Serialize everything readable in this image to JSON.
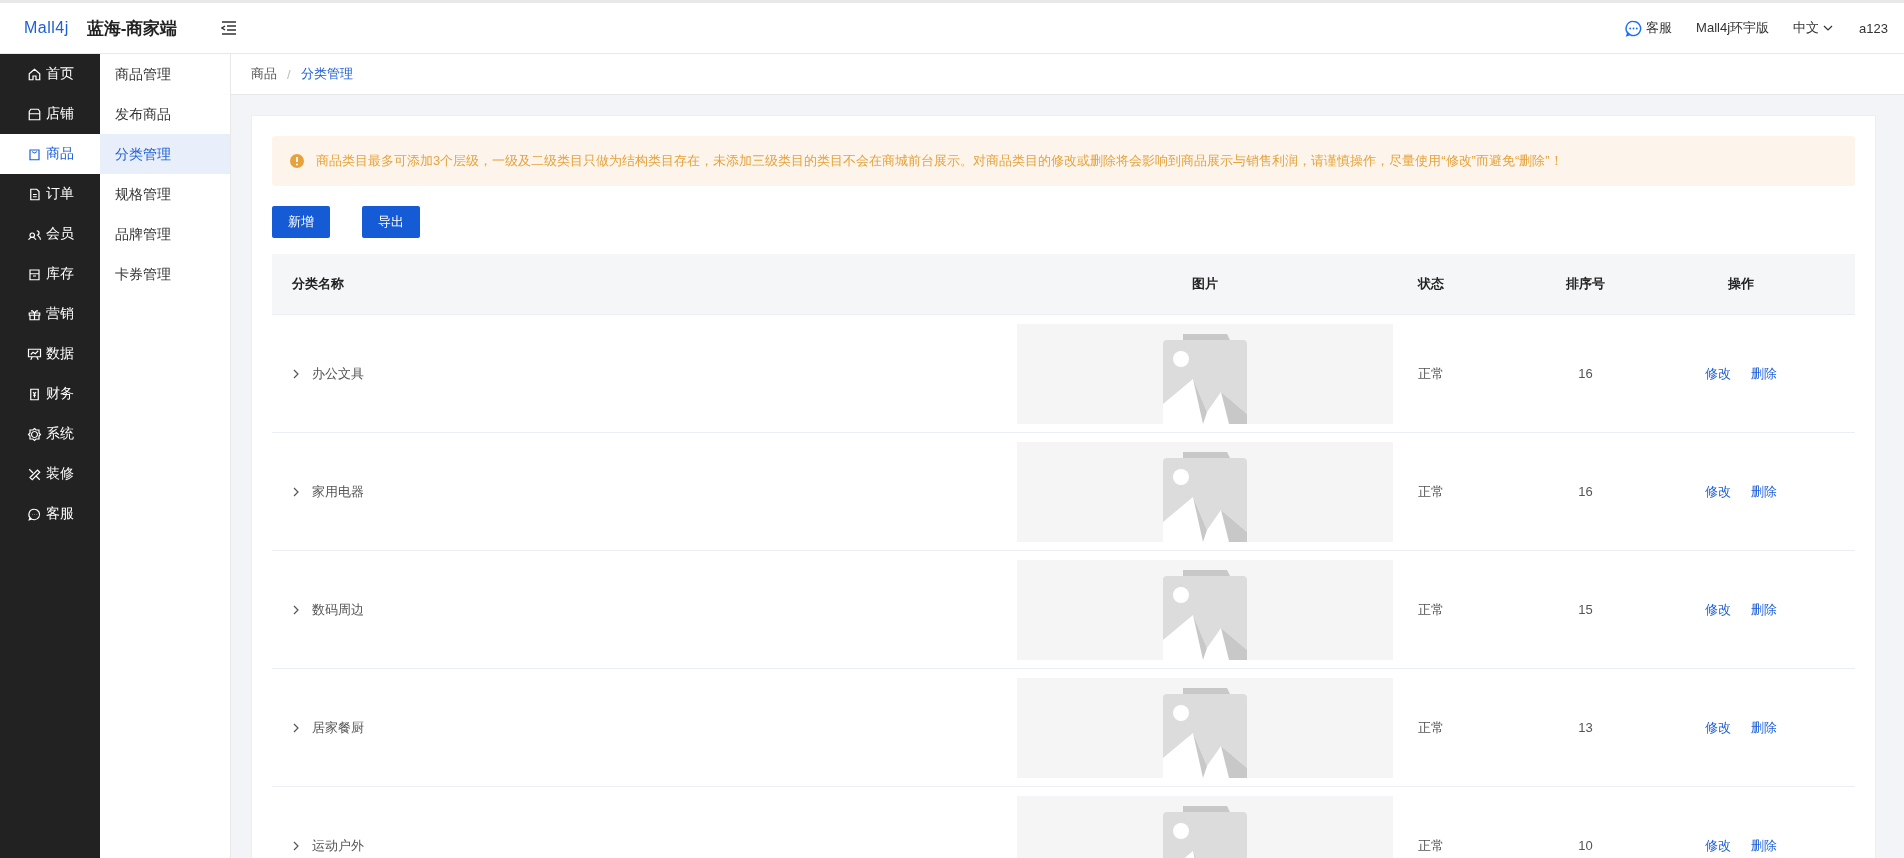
{
  "header": {
    "logo": "Mall4j",
    "title": "蓝海-商家端",
    "service": "客服",
    "edition": "Mall4j环宇版",
    "language": "中文",
    "user": "a123"
  },
  "sidebar": {
    "items": [
      {
        "label": "首页",
        "selected": false
      },
      {
        "label": "店铺",
        "selected": false
      },
      {
        "label": "商品",
        "selected": true
      },
      {
        "label": "订单",
        "selected": false
      },
      {
        "label": "会员",
        "selected": false
      },
      {
        "label": "库存",
        "selected": false
      },
      {
        "label": "营销",
        "selected": false
      },
      {
        "label": "数据",
        "selected": false
      },
      {
        "label": "财务",
        "selected": false
      },
      {
        "label": "系统",
        "selected": false
      },
      {
        "label": "装修",
        "selected": false
      },
      {
        "label": "客服",
        "selected": false
      }
    ]
  },
  "submenu": {
    "items": [
      {
        "label": "商品管理",
        "selected": false
      },
      {
        "label": "发布商品",
        "selected": false
      },
      {
        "label": "分类管理",
        "selected": true
      },
      {
        "label": "规格管理",
        "selected": false
      },
      {
        "label": "品牌管理",
        "selected": false
      },
      {
        "label": "卡券管理",
        "selected": false
      }
    ]
  },
  "breadcrumb": [
    "商品",
    "/",
    "分类管理"
  ],
  "alert": "商品类目最多可添加3个层级，一级及二级类目只做为结构类目存在，未添加三级类目的类目不会在商城前台展示。对商品类目的修改或删除将会影响到商品展示与销售利润，请谨慎操作，尽量使用“修改”而避免“删除”！",
  "buttons": [
    "新增",
    "导出"
  ],
  "table": {
    "columns": [
      "分类名称",
      "图片",
      "状态",
      "排序号",
      "操作"
    ],
    "rows": [
      {
        "name": "办公文具",
        "status": "正常",
        "sort": "16",
        "actions": [
          "修改",
          "删除"
        ]
      },
      {
        "name": "家用电器",
        "status": "正常",
        "sort": "16",
        "actions": [
          "修改",
          "删除"
        ]
      },
      {
        "name": "数码周边",
        "status": "正常",
        "sort": "15",
        "actions": [
          "修改",
          "删除"
        ]
      },
      {
        "name": "居家餐厨",
        "status": "正常",
        "sort": "13",
        "actions": [
          "修改",
          "删除"
        ]
      },
      {
        "name": "运动户外",
        "status": "正常",
        "sort": "10",
        "actions": [
          "修改",
          "删除"
        ]
      }
    ]
  }
}
